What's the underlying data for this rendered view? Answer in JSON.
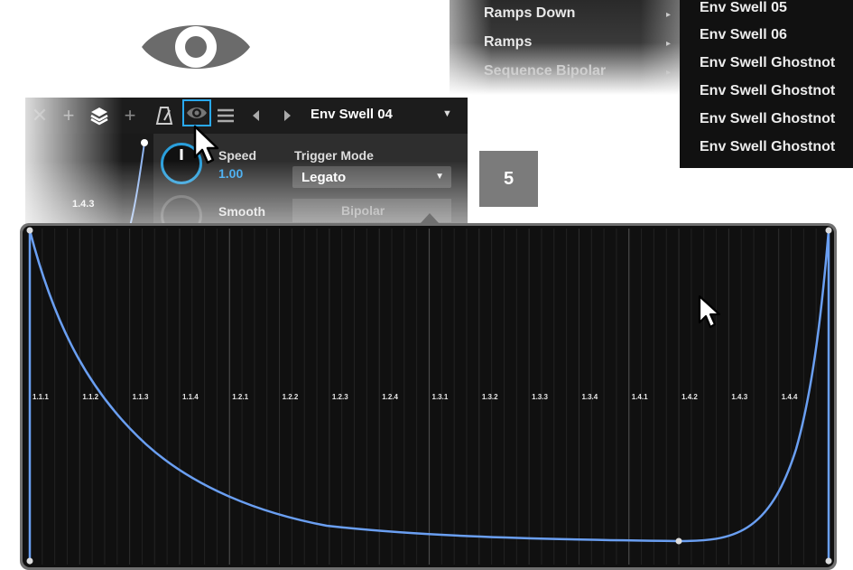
{
  "category_menu": {
    "items": [
      "Ramps Down",
      "Ramps",
      "Sequence Bipolar"
    ]
  },
  "preset_menu": {
    "items": [
      "Env Swell 05",
      "Env Swell 06",
      "Env Swell Ghostnot",
      "Env Swell Ghostnot",
      "Env Swell Ghostnot",
      "Env Swell Ghostnot"
    ]
  },
  "toolbar": {
    "preset_name": "Env Swell 04"
  },
  "device": {
    "mini_label": "1.4.3",
    "speed_label": "Speed",
    "speed_value": "1.00",
    "smooth_label": "Smooth",
    "trigger_mode_label": "Trigger Mode",
    "trigger_mode_value": "Legato",
    "bipolar_label": "Bipolar"
  },
  "step_badge": "5",
  "editor": {
    "beat_labels": [
      "1.1.1",
      "1.1.2",
      "1.1.3",
      "1.1.4",
      "1.2.1",
      "1.2.2",
      "1.2.3",
      "1.2.4",
      "1.3.1",
      "1.3.2",
      "1.3.3",
      "1.3.4",
      "1.4.1",
      "1.4.2",
      "1.4.3",
      "1.4.4"
    ],
    "curve_color": "#6a9ff2",
    "background_color": "#101010"
  },
  "icons": [
    "eye-icon",
    "close-icon",
    "plus-icon",
    "layers-icon",
    "metronome-icon",
    "list-icon",
    "prev-icon",
    "next-icon",
    "mouse-pointer-icon"
  ]
}
